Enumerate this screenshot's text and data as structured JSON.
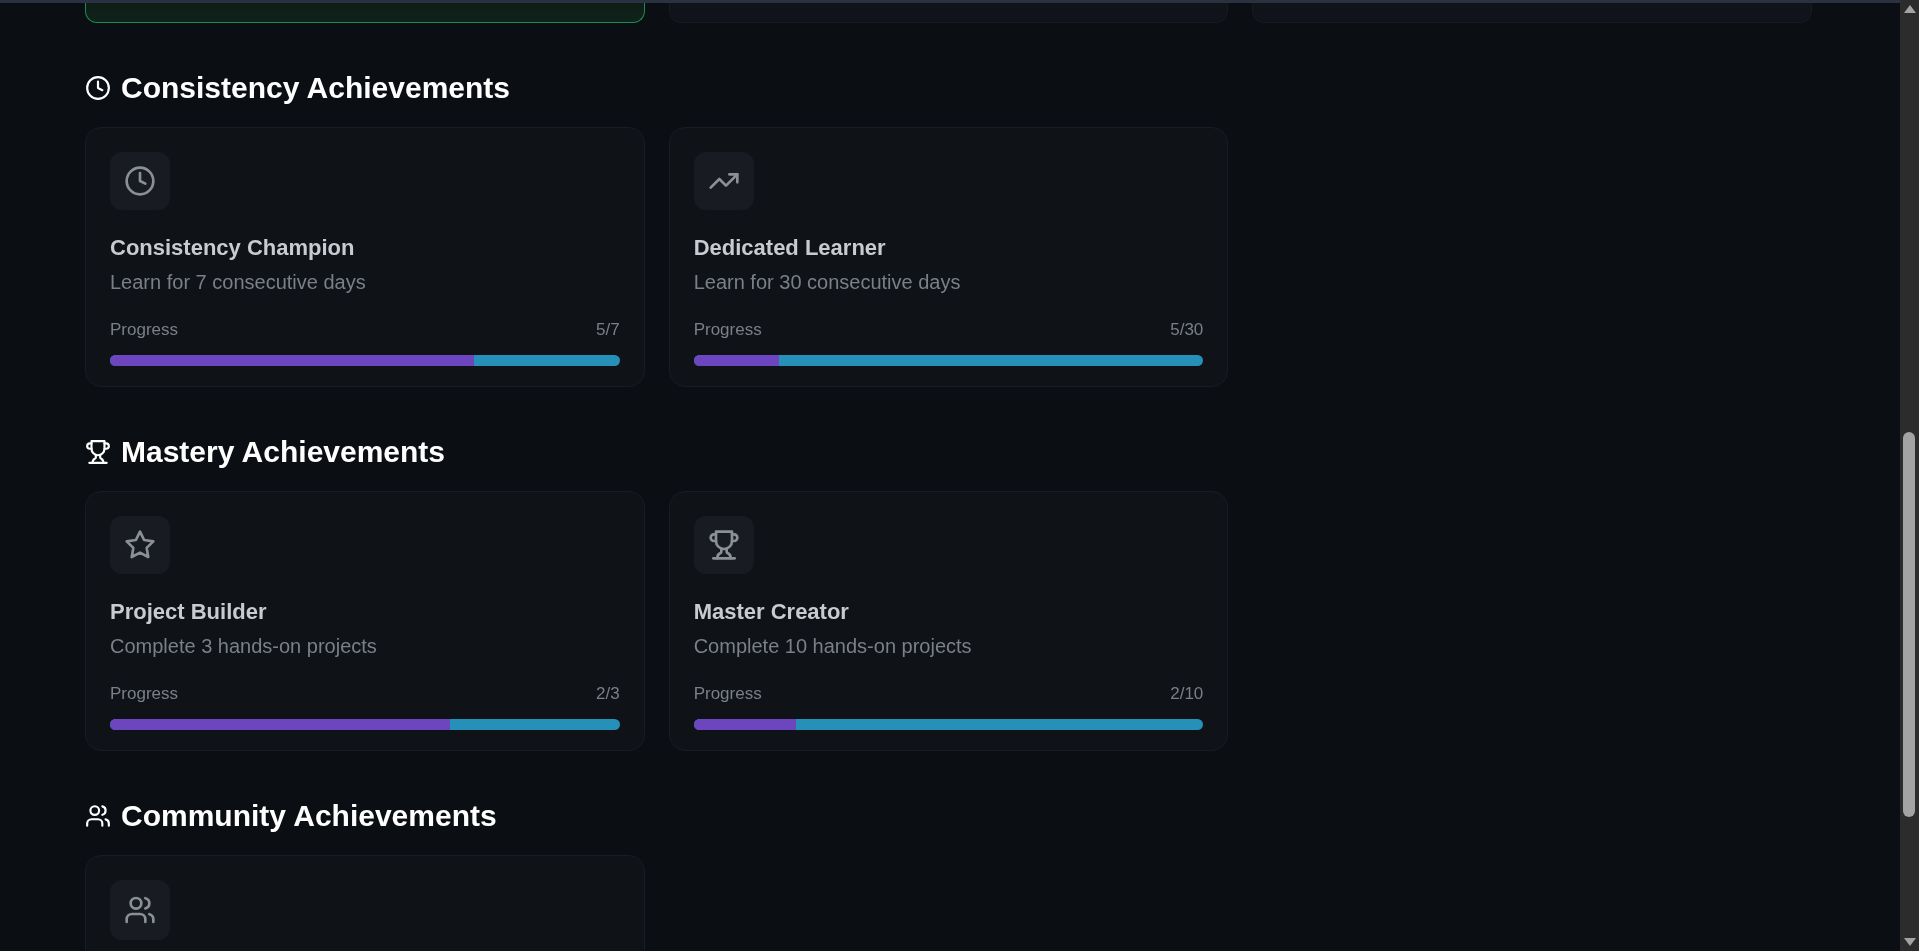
{
  "top_cards": [
    {
      "highlighted": true
    },
    {
      "highlighted": false
    },
    {
      "highlighted": false
    }
  ],
  "sections": [
    {
      "title": "Consistency Achievements",
      "kind": "clock",
      "cards": [
        {
          "kind": "clock",
          "title": "Consistency Champion",
          "description": "Learn for 7 consecutive days",
          "progress_label": "Progress",
          "progress_value": "5/7",
          "level": 0.714
        },
        {
          "kind": "trending",
          "title": "Dedicated Learner",
          "description": "Learn for 30 consecutive days",
          "progress_label": "Progress",
          "progress_value": "5/30",
          "level": 0.167
        }
      ]
    },
    {
      "title": "Mastery Achievements",
      "kind": "trophy",
      "cards": [
        {
          "kind": "star",
          "title": "Project Builder",
          "description": "Complete 3 hands-on projects",
          "progress_label": "Progress",
          "progress_value": "2/3",
          "level": 0.667
        },
        {
          "kind": "trophy",
          "title": "Master Creator",
          "description": "Complete 10 hands-on projects",
          "progress_label": "Progress",
          "progress_value": "2/10",
          "level": 0.2
        }
      ]
    },
    {
      "title": "Community Achievements",
      "kind": "users",
      "cards": [
        {
          "kind": "users"
        }
      ]
    }
  ]
}
